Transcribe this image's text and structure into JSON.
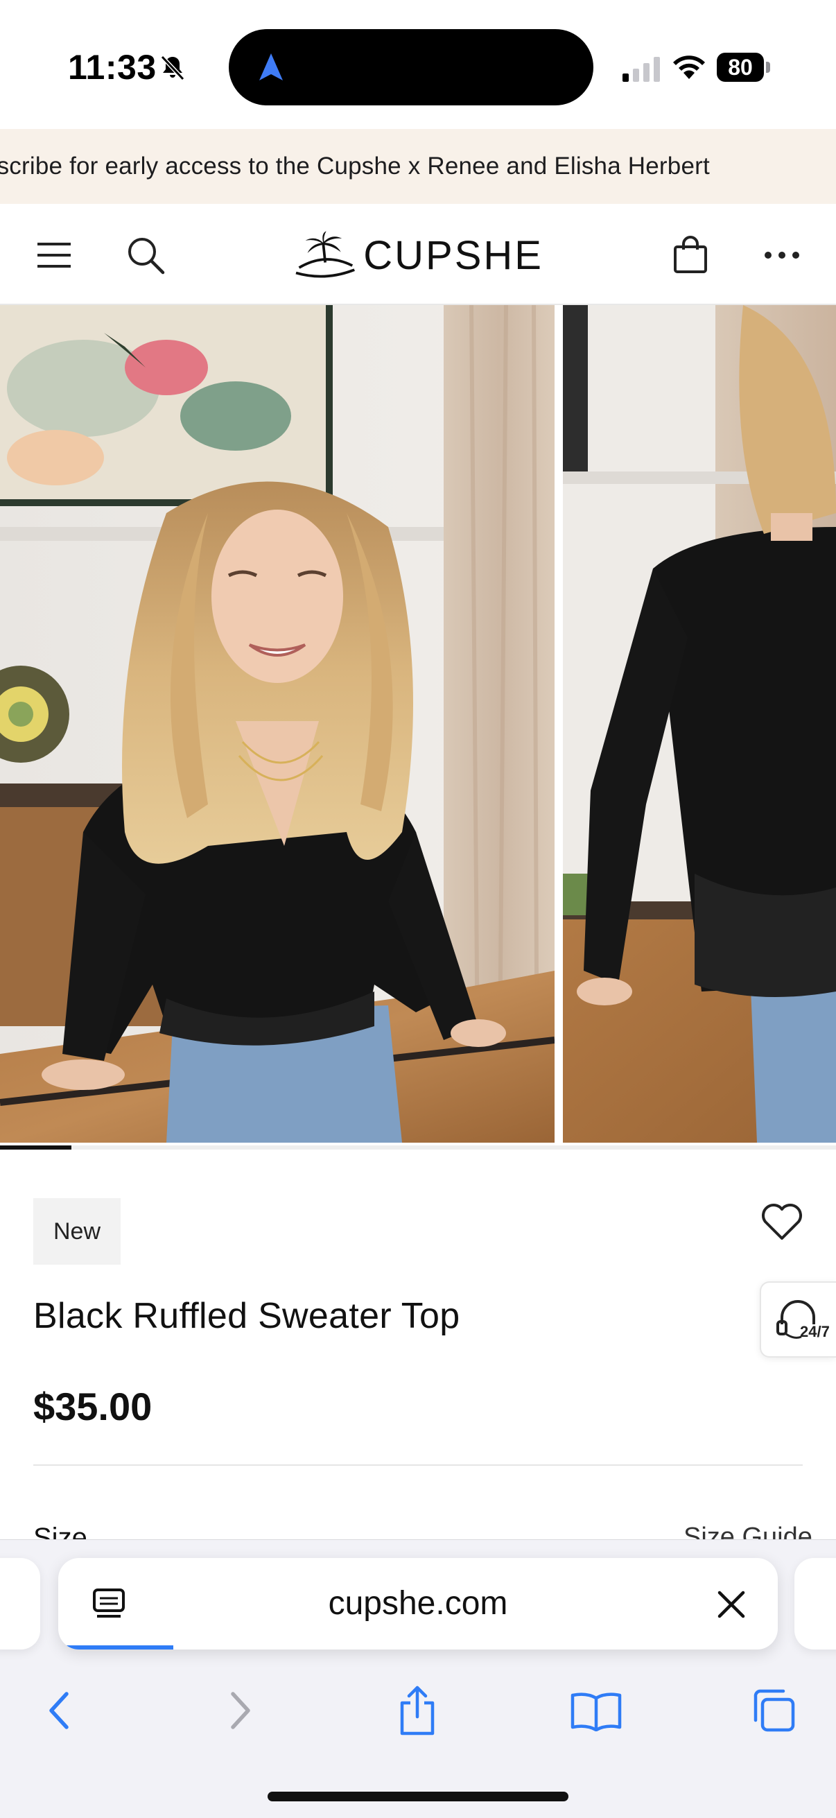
{
  "status_bar": {
    "time": "11:33",
    "battery": "80",
    "icons": [
      "bell-slash-icon",
      "location-arrow-icon",
      "cellular-signal-icon",
      "wifi-icon",
      "battery-icon"
    ]
  },
  "announcement": {
    "text": "ıbscribe for early access to the Cupshe x Renee and Elisha Herbert"
  },
  "header": {
    "logo_text": "CUPSHE",
    "icons": [
      "menu-icon",
      "search-icon",
      "palm-logo-icon",
      "bag-icon",
      "more-icon"
    ]
  },
  "gallery": {
    "images": [
      "model-front-photo",
      "model-back-photo"
    ],
    "progress_fraction": 0.085
  },
  "product": {
    "badge": "New",
    "title": "Black Ruffled Sweater Top",
    "price": "$35.00",
    "size_label": "Size",
    "size_guide": "Size Guide",
    "chat_label": "24/7"
  },
  "safari": {
    "url": "cupshe.com",
    "load_fraction": 0.16,
    "toolbar_icons": [
      "back-icon",
      "forward-icon",
      "share-icon",
      "bookmarks-icon",
      "tabs-icon"
    ]
  },
  "colors": {
    "announcement_bg": "#f8f1e9",
    "accent_blue": "#2f7cf6",
    "text": "#111111"
  }
}
